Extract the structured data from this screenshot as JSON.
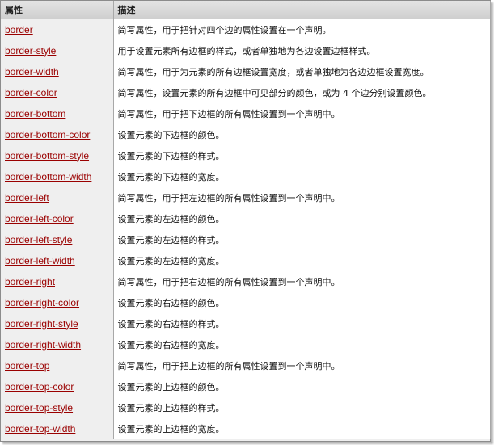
{
  "header": {
    "col_property": "属性",
    "col_description": "描述"
  },
  "rows": [
    {
      "property": "border",
      "description": "简写属性，用于把针对四个边的属性设置在一个声明。"
    },
    {
      "property": "border-style",
      "description": "用于设置元素所有边框的样式，或者单独地为各边设置边框样式。"
    },
    {
      "property": "border-width",
      "description": "简写属性，用于为元素的所有边框设置宽度，或者单独地为各边边框设置宽度。"
    },
    {
      "property": "border-color",
      "description": "简写属性，设置元素的所有边框中可见部分的颜色，或为 4 个边分别设置颜色。"
    },
    {
      "property": "border-bottom",
      "description": "简写属性，用于把下边框的所有属性设置到一个声明中。"
    },
    {
      "property": "border-bottom-color",
      "description": "设置元素的下边框的颜色。"
    },
    {
      "property": "border-bottom-style",
      "description": "设置元素的下边框的样式。"
    },
    {
      "property": "border-bottom-width",
      "description": "设置元素的下边框的宽度。"
    },
    {
      "property": "border-left",
      "description": "简写属性，用于把左边框的所有属性设置到一个声明中。"
    },
    {
      "property": "border-left-color",
      "description": "设置元素的左边框的颜色。"
    },
    {
      "property": "border-left-style",
      "description": "设置元素的左边框的样式。"
    },
    {
      "property": "border-left-width",
      "description": "设置元素的左边框的宽度。"
    },
    {
      "property": "border-right",
      "description": "简写属性，用于把右边框的所有属性设置到一个声明中。"
    },
    {
      "property": "border-right-color",
      "description": "设置元素的右边框的颜色。"
    },
    {
      "property": "border-right-style",
      "description": "设置元素的右边框的样式。"
    },
    {
      "property": "border-right-width",
      "description": "设置元素的右边框的宽度。"
    },
    {
      "property": "border-top",
      "description": "简写属性，用于把上边框的所有属性设置到一个声明中。"
    },
    {
      "property": "border-top-color",
      "description": "设置元素的上边框的颜色。"
    },
    {
      "property": "border-top-style",
      "description": "设置元素的上边框的样式。"
    },
    {
      "property": "border-top-width",
      "description": "设置元素的上边框的宽度。"
    }
  ],
  "colors": {
    "link": "#9a0000",
    "header_bg": "#d9d9d9",
    "property_cell_bg": "#efefef",
    "description_cell_bg": "#ffffff",
    "grid_line": "#a8a8a8"
  }
}
